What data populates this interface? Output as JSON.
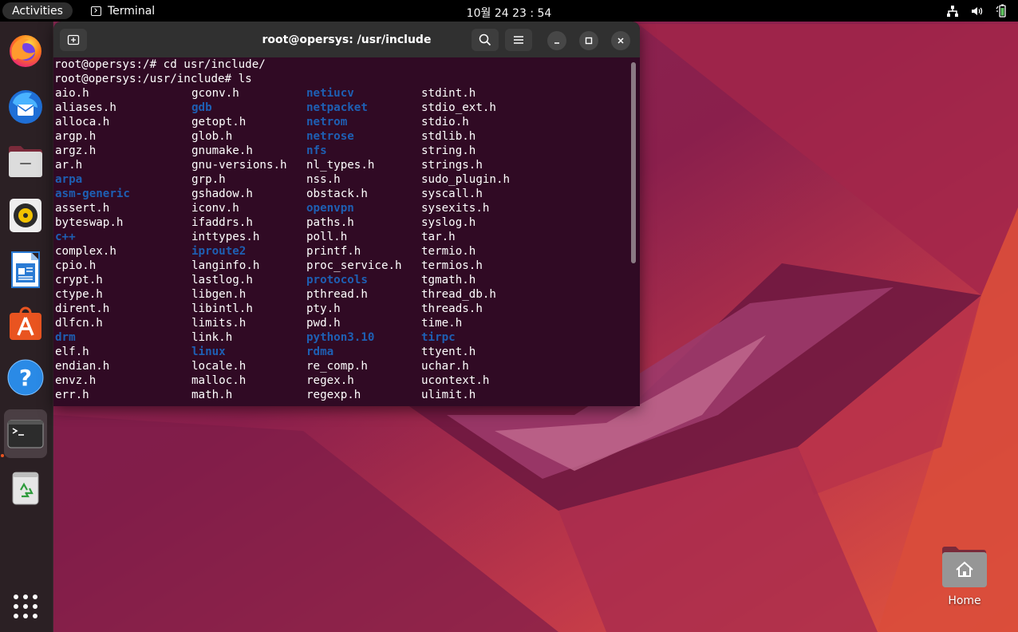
{
  "topbar": {
    "activities_label": "Activities",
    "app_name": "Terminal",
    "clock": "10월 24  23 : 54",
    "tray_icons": [
      "network-icon",
      "volume-icon",
      "battery-icon"
    ]
  },
  "dock": {
    "items": [
      {
        "name": "firefox",
        "icon": "firefox-icon"
      },
      {
        "name": "thunderbird",
        "icon": "thunderbird-icon"
      },
      {
        "name": "files",
        "icon": "files-icon"
      },
      {
        "name": "rhythmbox",
        "icon": "rhythmbox-icon"
      },
      {
        "name": "libreoffice-writer",
        "icon": "writer-icon"
      },
      {
        "name": "software",
        "icon": "software-store-icon"
      },
      {
        "name": "help",
        "icon": "help-icon"
      },
      {
        "name": "terminal",
        "icon": "terminal-icon",
        "active": true
      },
      {
        "name": "trash",
        "icon": "trash-icon"
      }
    ],
    "show_apps_icon": "app-grid-icon"
  },
  "terminal": {
    "title": "root@opersys: /usr/include",
    "lines": [
      "root@opersys:/# cd usr/include/",
      "root@opersys:/usr/include# ls"
    ],
    "ls_rows": [
      [
        {
          "t": "aio.h"
        },
        {
          "t": "gconv.h"
        },
        {
          "t": "netiucv",
          "d": true
        },
        {
          "t": "stdint.h"
        }
      ],
      [
        {
          "t": "aliases.h"
        },
        {
          "t": "gdb",
          "d": true
        },
        {
          "t": "netpacket",
          "d": true
        },
        {
          "t": "stdio_ext.h"
        }
      ],
      [
        {
          "t": "alloca.h"
        },
        {
          "t": "getopt.h"
        },
        {
          "t": "netrom",
          "d": true
        },
        {
          "t": "stdio.h"
        }
      ],
      [
        {
          "t": "argp.h"
        },
        {
          "t": "glob.h"
        },
        {
          "t": "netrose",
          "d": true
        },
        {
          "t": "stdlib.h"
        }
      ],
      [
        {
          "t": "argz.h"
        },
        {
          "t": "gnumake.h"
        },
        {
          "t": "nfs",
          "d": true
        },
        {
          "t": "string.h"
        }
      ],
      [
        {
          "t": "ar.h"
        },
        {
          "t": "gnu-versions.h"
        },
        {
          "t": "nl_types.h"
        },
        {
          "t": "strings.h"
        }
      ],
      [
        {
          "t": "arpa",
          "d": true
        },
        {
          "t": "grp.h"
        },
        {
          "t": "nss.h"
        },
        {
          "t": "sudo_plugin.h"
        }
      ],
      [
        {
          "t": "asm-generic",
          "d": true
        },
        {
          "t": "gshadow.h"
        },
        {
          "t": "obstack.h"
        },
        {
          "t": "syscall.h"
        }
      ],
      [
        {
          "t": "assert.h"
        },
        {
          "t": "iconv.h"
        },
        {
          "t": "openvpn",
          "d": true
        },
        {
          "t": "sysexits.h"
        }
      ],
      [
        {
          "t": "byteswap.h"
        },
        {
          "t": "ifaddrs.h"
        },
        {
          "t": "paths.h"
        },
        {
          "t": "syslog.h"
        }
      ],
      [
        {
          "t": "c++",
          "d": true
        },
        {
          "t": "inttypes.h"
        },
        {
          "t": "poll.h"
        },
        {
          "t": "tar.h"
        }
      ],
      [
        {
          "t": "complex.h"
        },
        {
          "t": "iproute2",
          "d": true
        },
        {
          "t": "printf.h"
        },
        {
          "t": "termio.h"
        }
      ],
      [
        {
          "t": "cpio.h"
        },
        {
          "t": "langinfo.h"
        },
        {
          "t": "proc_service.h"
        },
        {
          "t": "termios.h"
        }
      ],
      [
        {
          "t": "crypt.h"
        },
        {
          "t": "lastlog.h"
        },
        {
          "t": "protocols",
          "d": true
        },
        {
          "t": "tgmath.h"
        }
      ],
      [
        {
          "t": "ctype.h"
        },
        {
          "t": "libgen.h"
        },
        {
          "t": "pthread.h"
        },
        {
          "t": "thread_db.h"
        }
      ],
      [
        {
          "t": "dirent.h"
        },
        {
          "t": "libintl.h"
        },
        {
          "t": "pty.h"
        },
        {
          "t": "threads.h"
        }
      ],
      [
        {
          "t": "dlfcn.h"
        },
        {
          "t": "limits.h"
        },
        {
          "t": "pwd.h"
        },
        {
          "t": "time.h"
        }
      ],
      [
        {
          "t": "drm",
          "d": true
        },
        {
          "t": "link.h"
        },
        {
          "t": "python3.10",
          "d": true
        },
        {
          "t": "tirpc",
          "d": true
        }
      ],
      [
        {
          "t": "elf.h"
        },
        {
          "t": "linux",
          "d": true
        },
        {
          "t": "rdma",
          "d": true
        },
        {
          "t": "ttyent.h"
        }
      ],
      [
        {
          "t": "endian.h"
        },
        {
          "t": "locale.h"
        },
        {
          "t": "re_comp.h"
        },
        {
          "t": "uchar.h"
        }
      ],
      [
        {
          "t": "envz.h"
        },
        {
          "t": "malloc.h"
        },
        {
          "t": "regex.h"
        },
        {
          "t": "ucontext.h"
        }
      ],
      [
        {
          "t": "err.h"
        },
        {
          "t": "math.h"
        },
        {
          "t": "regexp.h"
        },
        {
          "t": "ulimit.h"
        }
      ]
    ]
  },
  "desktop": {
    "home_label": "Home"
  },
  "colors": {
    "terminal_bg": "#300a24",
    "directory": "#1e5fb3",
    "accent": "#e95420"
  }
}
